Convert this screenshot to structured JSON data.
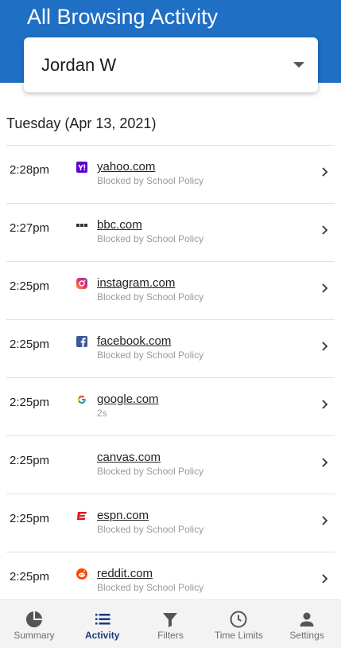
{
  "header": {
    "title": "All Browsing Activity"
  },
  "user_select": {
    "value": "Jordan W"
  },
  "date_heading": "Tuesday (Apr 13, 2021)",
  "activity": [
    {
      "time": "2:28pm",
      "site": "yahoo.com",
      "status": "Blocked by School Policy",
      "icon": "yahoo-icon"
    },
    {
      "time": "2:27pm",
      "site": "bbc.com",
      "status": "Blocked by School Policy",
      "icon": "bbc-icon"
    },
    {
      "time": "2:25pm",
      "site": "instagram.com",
      "status": "Blocked by School Policy",
      "icon": "instagram-icon"
    },
    {
      "time": "2:25pm",
      "site": "facebook.com",
      "status": "Blocked by School Policy",
      "icon": "facebook-icon"
    },
    {
      "time": "2:25pm",
      "site": "google.com",
      "status": "2s",
      "icon": "google-icon"
    },
    {
      "time": "2:25pm",
      "site": "canvas.com",
      "status": "Blocked by School Policy",
      "icon": ""
    },
    {
      "time": "2:25pm",
      "site": "espn.com",
      "status": "Blocked by School Policy",
      "icon": "espn-icon"
    },
    {
      "time": "2:25pm",
      "site": "reddit.com",
      "status": "Blocked by School Policy",
      "icon": "reddit-icon"
    }
  ],
  "nav": {
    "summary": "Summary",
    "activity": "Activity",
    "filters": "Filters",
    "time_limits": "Time Limits",
    "settings": "Settings"
  },
  "colors": {
    "header": "#1f6fc4",
    "active_nav": "#1a3a7a"
  }
}
